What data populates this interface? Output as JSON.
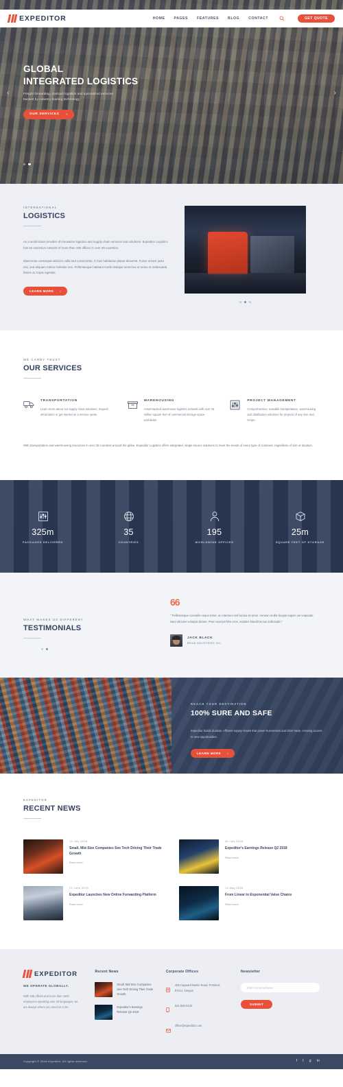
{
  "brand": {
    "name": "EXPEDITOR",
    "accent": "#e8503a",
    "dark": "#3a4964"
  },
  "header": {
    "nav": [
      {
        "label": "HOME"
      },
      {
        "label": "PAGES"
      },
      {
        "label": "FEATURES"
      },
      {
        "label": "BLOG"
      },
      {
        "label": "CONTACT"
      }
    ],
    "search_icon": "search-icon",
    "quote_button": "GET QUOTE"
  },
  "hero": {
    "title_line1": "GLOBAL",
    "title_line2": "INTEGRATED LOGISTICS",
    "subtitle_line1": "Freight forwarding, contract logistics and specialized services",
    "subtitle_line2": "backed by industry-leading technology.",
    "button": "OUR SERVICES",
    "prev_icon": "chevron-left-icon",
    "next_icon": "chevron-right-icon",
    "slides": 2,
    "active_slide": 2
  },
  "logistics": {
    "eyebrow": "INTERNATIONAL",
    "title": "LOGISTICS",
    "paragraph1": "As a world-class provider of innovative logistics and supply chain services and solutions, Expeditor Logistics has an extensive network of more than 195 offices in over 35 countries.",
    "paragraph2": "Maecenas consequat ultricies nulla sed consectetur. In hac habitasse platea dictumst. Fusce ornare justo nisi, sed aliquam metus molestie nec. Pellentesque habitant morbi tristique senectus et netus et malesuada fames ac turpis egestas.",
    "button": "LEARN MORE",
    "slides": 3,
    "active_slide": 2
  },
  "services": {
    "eyebrow": "WE CARRY TRUST",
    "title": "OUR SERVICES",
    "items": [
      {
        "icon": "truck-icon",
        "title": "TRANSPORTATION",
        "desc": "Learn more about our supply chain solutions, request information or get started on a service quote."
      },
      {
        "icon": "warehouse-box-icon",
        "title": "WAREHOUSING",
        "desc": "Asset-backed warehouse logistics network with over 25 million square feet of commercial storage space worldwide."
      },
      {
        "icon": "sliders-icon",
        "title": "PROJECT MANAGEMENT",
        "desc": "Comprehensive, scalable transportation, warehousing and distribution solutions for projects of any size and scope."
      }
    ],
    "footer_text": "With transportation and warehousing resources in over 35 countries around the globe, Expeditor Logistics offers integrated, single-source solutions to meet the needs of every type of customer, regardless of size or location."
  },
  "stats": [
    {
      "icon": "crate-icon",
      "value": "325m",
      "label": "PACKAGES DELIVERED"
    },
    {
      "icon": "globe-icon",
      "value": "35",
      "label": "COUNTRIES"
    },
    {
      "icon": "person-icon",
      "value": "195",
      "label": "WORLDWIDE OFFICES"
    },
    {
      "icon": "box-3d-icon",
      "value": "25m",
      "label": "SQUARE FEET OF STORAGE"
    }
  ],
  "testimonials": {
    "eyebrow": "WHAT MAKES US DIFFERENT",
    "title": "TESTIMONIALS",
    "quote_mark": "66",
    "quote": "\" Pellentesque convallis neque tortor, ac interdum nisl lacinia sit amet. Aenean mollis feugiat sapien vel vulputate. Nam ultricies volutpat dictum. Proin suscipit felis eros, sodales blandit lectus sollicitudin.\"",
    "author_name": "JACK BLACK",
    "author_company": "BEAM INDUSTRIES INC.",
    "slides": 2,
    "active_slide": 2
  },
  "cta": {
    "eyebrow": "REACH YOUR DESTINATION",
    "title": "100% SURE AND SAFE",
    "text": "Expeditor builds durable, efficient supply chains that power businesses and drive trade, creating access to new opportunities.",
    "button": "LEARN MORE"
  },
  "news": {
    "eyebrow": "EXPEDITOR",
    "title": "RECENT NEWS",
    "read_more": "Read more",
    "items": [
      {
        "date": "12 July 2018",
        "title": "Small, Mid-Size Companies See Tech Driving Their Trade Growth",
        "thumb": "nt1"
      },
      {
        "date": "30 July 2018",
        "title": "Expeditor's Earnings Release Q2 2018",
        "thumb": "nt2"
      },
      {
        "date": "21 June 2018",
        "title": "Expeditor Launches New Online Forwarding Platform",
        "thumb": "nt3"
      },
      {
        "date": "14 May 2018",
        "title": "From Linear to Exponential Value Chains",
        "thumb": "nt4"
      }
    ]
  },
  "footer": {
    "tagline": "WE OPERATE GLOBALLY.",
    "description": "With 195 offices and more than 1600 employees speaking over 40 languages, we are always where you need us to be.",
    "recent_news_head": "Recent News",
    "recent_news": [
      {
        "title": "Small, Mid-Size Companies See Tech Driving Their Trade Growth"
      },
      {
        "title": "Expeditor's Earnings Release Q2 2018"
      }
    ],
    "offices_head": "Corporate Offices",
    "address_icon": "map-pin-icon",
    "address": "409 Hayward Banks Road, Portland, 97214, Oregon",
    "phone_icon": "phone-icon",
    "phone": "541-555-5132",
    "email_icon": "envelope-icon",
    "email": "office@expeditor.com",
    "newsletter_head": "Newsletter",
    "newsletter_placeholder": "Enter Email address",
    "newsletter_value": "",
    "submit": "SUBMIT",
    "copyright": "Copyright © 2018 eXpeditor. All rights reserved.",
    "socials": [
      {
        "icon": "facebook-icon",
        "glyph": "f"
      },
      {
        "icon": "twitter-icon",
        "glyph": "t"
      },
      {
        "icon": "google-plus-icon",
        "glyph": "g"
      },
      {
        "icon": "linkedin-icon",
        "glyph": "in"
      }
    ]
  }
}
